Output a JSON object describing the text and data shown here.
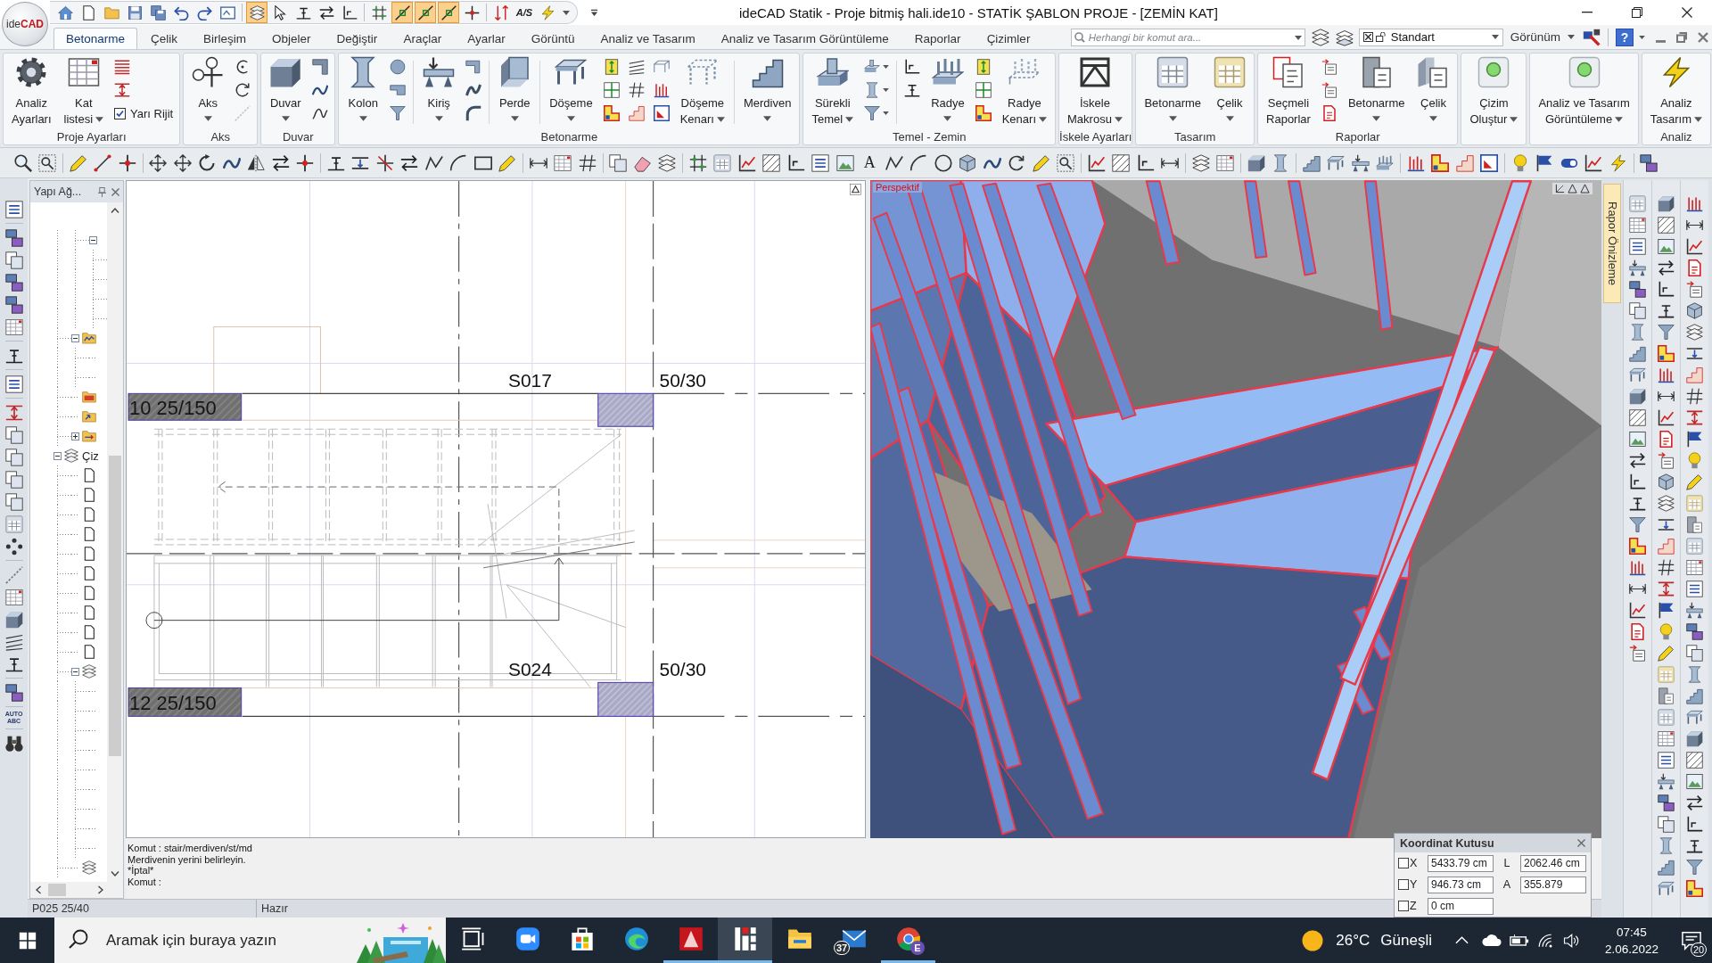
{
  "title_bar": {
    "logo": "ide**CAD**",
    "title": "ideCAD Statik - Proje bitmiş hali.ide10 - STATİK ŞABLON PROJE - [ZEMİN KAT]",
    "quick_access": [
      {
        "on": false
      },
      {
        "on": false
      },
      {
        "on": false
      },
      {
        "on": false
      },
      {
        "on": false
      },
      {
        "on": false
      },
      {
        "on": false
      },
      {
        "on": false
      },
      {
        "on": true
      },
      {
        "on": false
      },
      {
        "on": false
      },
      {
        "on": false
      },
      {
        "on": false
      },
      {
        "on": false
      },
      {
        "on": true
      },
      {
        "on": true
      },
      {
        "on": true
      },
      {
        "on": false
      },
      {
        "on": false
      },
      {
        "on": false,
        "glyph": "A/S"
      },
      {
        "on": false
      }
    ]
  },
  "tabs": [
    {
      "label": "Betonarme",
      "selected": true
    },
    {
      "label": "Çelik",
      "selected": false
    },
    {
      "label": "Birleşim",
      "selected": false
    },
    {
      "label": "Objeler",
      "selected": false
    },
    {
      "label": "Değiştir",
      "selected": false
    },
    {
      "label": "Araçlar",
      "selected": false
    },
    {
      "label": "Ayarlar",
      "selected": false
    },
    {
      "label": "Görüntü",
      "selected": false
    },
    {
      "label": "Analiz ve Tasarım",
      "selected": false
    },
    {
      "label": "Analiz ve Tasarım Görüntüleme",
      "selected": false
    },
    {
      "label": "Raporlar",
      "selected": false
    },
    {
      "label": "Çizimler",
      "selected": false
    }
  ],
  "tab_bar": {
    "search": {
      "placeholder": "Herhangi bir komut ara..."
    },
    "style_combo": "Standart",
    "view_menu": "Görünüm",
    "help": "?"
  },
  "ribbon": [
    {
      "title": "Proje Ayarları",
      "items": [
        {
          "kind": "large",
          "lines": [
            "Analiz",
            "Ayarları"
          ],
          "dropdown": false
        },
        {
          "kind": "large",
          "lines": [
            "Kat",
            "listesi"
          ],
          "dropdown": true
        },
        {
          "kind": "stack",
          "items": [
            {
              "kind": "icon"
            },
            {
              "kind": "icon"
            },
            {
              "kind": "check",
              "label": "Yarı Rijit",
              "checked": true
            }
          ]
        }
      ]
    },
    {
      "title": "Aks",
      "items": [
        {
          "kind": "large",
          "lines": [
            "Aks"
          ],
          "dropdown": true
        },
        {
          "kind": "stack",
          "items": [
            {
              "kind": "icon",
              "disabled": false
            },
            {
              "kind": "icon",
              "disabled": false
            },
            {
              "kind": "icon",
              "disabled": true
            }
          ]
        }
      ]
    },
    {
      "title": "Duvar",
      "items": [
        {
          "kind": "large",
          "lines": [
            "Duvar"
          ],
          "dropdown": true
        },
        {
          "kind": "stack",
          "items": [
            {
              "kind": "icon"
            },
            {
              "kind": "icon"
            },
            {
              "kind": "icon"
            }
          ]
        }
      ]
    },
    {
      "title": "Betonarme",
      "items": [
        {
          "kind": "large",
          "lines": [
            "Kolon"
          ],
          "dropdown": true
        },
        {
          "kind": "stack",
          "items": [
            {
              "kind": "icon"
            },
            {
              "kind": "icon"
            },
            {
              "kind": "icon"
            }
          ]
        },
        {
          "kind": "separator"
        },
        {
          "kind": "large",
          "lines": [
            "Kiriş"
          ],
          "dropdown": true
        },
        {
          "kind": "stack",
          "items": [
            {
              "kind": "icon"
            },
            {
              "kind": "icon"
            },
            {
              "kind": "icon"
            }
          ]
        },
        {
          "kind": "separator"
        },
        {
          "kind": "large",
          "lines": [
            "Perde"
          ],
          "dropdown": true
        },
        {
          "kind": "separator"
        },
        {
          "kind": "large",
          "lines": [
            "Döşeme"
          ],
          "dropdown": true
        },
        {
          "kind": "stack",
          "items": [
            {
              "kind": "icon"
            },
            {
              "kind": "icon"
            },
            {
              "kind": "icon"
            }
          ]
        },
        {
          "kind": "stack",
          "items": [
            {
              "kind": "icon"
            },
            {
              "kind": "icon"
            },
            {
              "kind": "icon"
            }
          ]
        },
        {
          "kind": "stack",
          "items": [
            {
              "kind": "icon"
            },
            {
              "kind": "icon"
            },
            {
              "kind": "icon"
            }
          ]
        },
        {
          "kind": "large",
          "lines": [
            "Döşeme",
            "Kenarı"
          ],
          "dropdown": true
        },
        {
          "kind": "separator"
        },
        {
          "kind": "large",
          "lines": [
            "Merdiven"
          ],
          "dropdown": true
        }
      ]
    },
    {
      "title": "Temel - Zemin",
      "items": [
        {
          "kind": "large",
          "lines": [
            "Sürekli",
            "Temel"
          ],
          "dropdown": true
        },
        {
          "kind": "stack",
          "items": [
            {
              "kind": "icon",
              "dropdown": true
            },
            {
              "kind": "icon",
              "dropdown": true
            },
            {
              "kind": "icon",
              "dropdown": true
            }
          ]
        },
        {
          "kind": "separator"
        },
        {
          "kind": "stack",
          "items": [
            {
              "kind": "icon"
            },
            {
              "kind": "icon"
            }
          ]
        },
        {
          "kind": "large",
          "lines": [
            "Radye"
          ],
          "dropdown": true
        },
        {
          "kind": "stack",
          "items": [
            {
              "kind": "icon"
            },
            {
              "kind": "icon"
            },
            {
              "kind": "icon"
            }
          ]
        },
        {
          "kind": "large",
          "lines": [
            "Radye",
            "Kenarı"
          ],
          "dropdown": true
        }
      ]
    },
    {
      "title": "İskele Ayarları",
      "items": [
        {
          "kind": "large",
          "lines": [
            "İskele",
            "Makrosu"
          ],
          "dropdown": true
        }
      ]
    },
    {
      "title": "Tasarım",
      "items": [
        {
          "kind": "large",
          "lines": [
            "Betonarme"
          ],
          "dropdown": true
        },
        {
          "kind": "large",
          "lines": [
            "Çelik"
          ],
          "dropdown": true
        }
      ]
    },
    {
      "title": "Raporlar",
      "items": [
        {
          "kind": "large",
          "lines": [
            "Seçmeli",
            "Raporlar"
          ],
          "dropdown": false
        },
        {
          "kind": "stack",
          "items": [
            {
              "kind": "icon"
            },
            {
              "kind": "icon"
            },
            {
              "kind": "icon"
            }
          ]
        },
        {
          "kind": "large",
          "lines": [
            "Betonarme"
          ],
          "dropdown": true
        },
        {
          "kind": "large",
          "lines": [
            "Çelik"
          ],
          "dropdown": true
        }
      ]
    },
    {
      "items": [
        {
          "kind": "large",
          "lines": [
            "Çizim",
            "Oluştur"
          ],
          "dropdown": true
        }
      ]
    },
    {
      "items": [
        {
          "kind": "large",
          "lines": [
            "Analiz ve Tasarım",
            "Görüntüleme"
          ],
          "dropdown": true
        }
      ]
    },
    {
      "title": "Analiz",
      "items": [
        {
          "kind": "large",
          "lines": [
            "Analiz",
            "Tasarım"
          ],
          "dropdown": true
        }
      ]
    }
  ],
  "toolbar": {
    "text_tool": "A"
  },
  "left_toolbar": {
    "auto_label": [
      "AUTO",
      "ABC"
    ]
  },
  "tree": {
    "title": "Yapı Ağ...",
    "nodes": [
      {
        "kind": "offscreen",
        "children": [
          {
            "kind": "offscreen",
            "children": [
              {
                "kind": "blank",
                "expanded": true,
                "children": [
                  {
                    "kind": "stub"
                  },
                  {
                    "kind": "stub"
                  },
                  {
                    "kind": "stub"
                  },
                  {
                    "kind": "stub"
                  }
                ]
              }
            ]
          },
          {
            "kind": "chart-folder",
            "expanded": true,
            "children": [
              {
                "kind": "stub"
              },
              {
                "kind": "stub"
              }
            ]
          },
          {
            "kind": "tile-folder"
          },
          {
            "kind": "arrow-folder"
          },
          {
            "kind": "plus-folder",
            "expanded": false
          }
        ]
      },
      {
        "kind": "drawing-set",
        "label": "Çiz",
        "expanded": true,
        "children": [
          {
            "kind": "page"
          },
          {
            "kind": "page"
          },
          {
            "kind": "page"
          },
          {
            "kind": "page"
          },
          {
            "kind": "page"
          },
          {
            "kind": "page"
          },
          {
            "kind": "page"
          },
          {
            "kind": "page"
          },
          {
            "kind": "page"
          },
          {
            "kind": "page"
          },
          {
            "kind": "layers",
            "expanded": true,
            "children": [
              {
                "kind": "stub"
              },
              {
                "kind": "stub"
              },
              {
                "kind": "stub"
              },
              {
                "kind": "stub"
              },
              {
                "kind": "stub"
              },
              {
                "kind": "stub"
              },
              {
                "kind": "stub"
              },
              {
                "kind": "stub"
              },
              {
                "kind": "stub"
              }
            ]
          },
          {
            "kind": "layers"
          }
        ]
      }
    ]
  },
  "plan": {
    "slabs": [
      "S017",
      "S024"
    ],
    "columns": [
      "50/30",
      "50/30"
    ],
    "beams": [
      "10 25/150",
      "12 25/150"
    ]
  },
  "view3d": {
    "label": "Perspektif"
  },
  "side_tab": "Rapor Önizleme",
  "command_lines": [
    "Komut : stair/merdiven/st/md",
    "Merdivenin yerini belirleyin.",
    "*İptal*",
    "Komut :"
  ],
  "status_bar": [
    "P025 25/40",
    "Hazır"
  ],
  "coordinate_box": {
    "title": "Koordinat Kutusu",
    "rows": [
      {
        "axis": "X",
        "checked": false,
        "value": "5433.79 cm",
        "label": "L",
        "extra": "2062.46 cm"
      },
      {
        "axis": "Y",
        "checked": false,
        "value": "946.73 cm",
        "label": "A",
        "extra": "355.879"
      },
      {
        "axis": "Z",
        "checked": false,
        "value": "0 cm"
      }
    ]
  },
  "taskbar": {
    "search": {
      "placeholder": "Aramak için buraya yazın"
    },
    "apps": [
      {
        "kind": "task-view",
        "running": false,
        "selected": false
      },
      {
        "kind": "zoom",
        "running": false,
        "selected": false
      },
      {
        "kind": "store",
        "running": false,
        "selected": false
      },
      {
        "kind": "edge",
        "running": false,
        "selected": false
      },
      {
        "kind": "autocad",
        "running": true,
        "selected": false
      },
      {
        "kind": "idecad",
        "running": true,
        "selected": true
      },
      {
        "kind": "explorer",
        "running": false,
        "selected": false
      },
      {
        "kind": "mail",
        "running": false,
        "selected": false,
        "badge": "37"
      },
      {
        "kind": "chrome",
        "running": true,
        "selected": false,
        "badge": "E"
      }
    ],
    "weather": {
      "temperature": "26°C",
      "condition": "Güneşli"
    },
    "clock": {
      "time": "07:45",
      "date": "2.06.2022"
    },
    "notifications": "20"
  }
}
